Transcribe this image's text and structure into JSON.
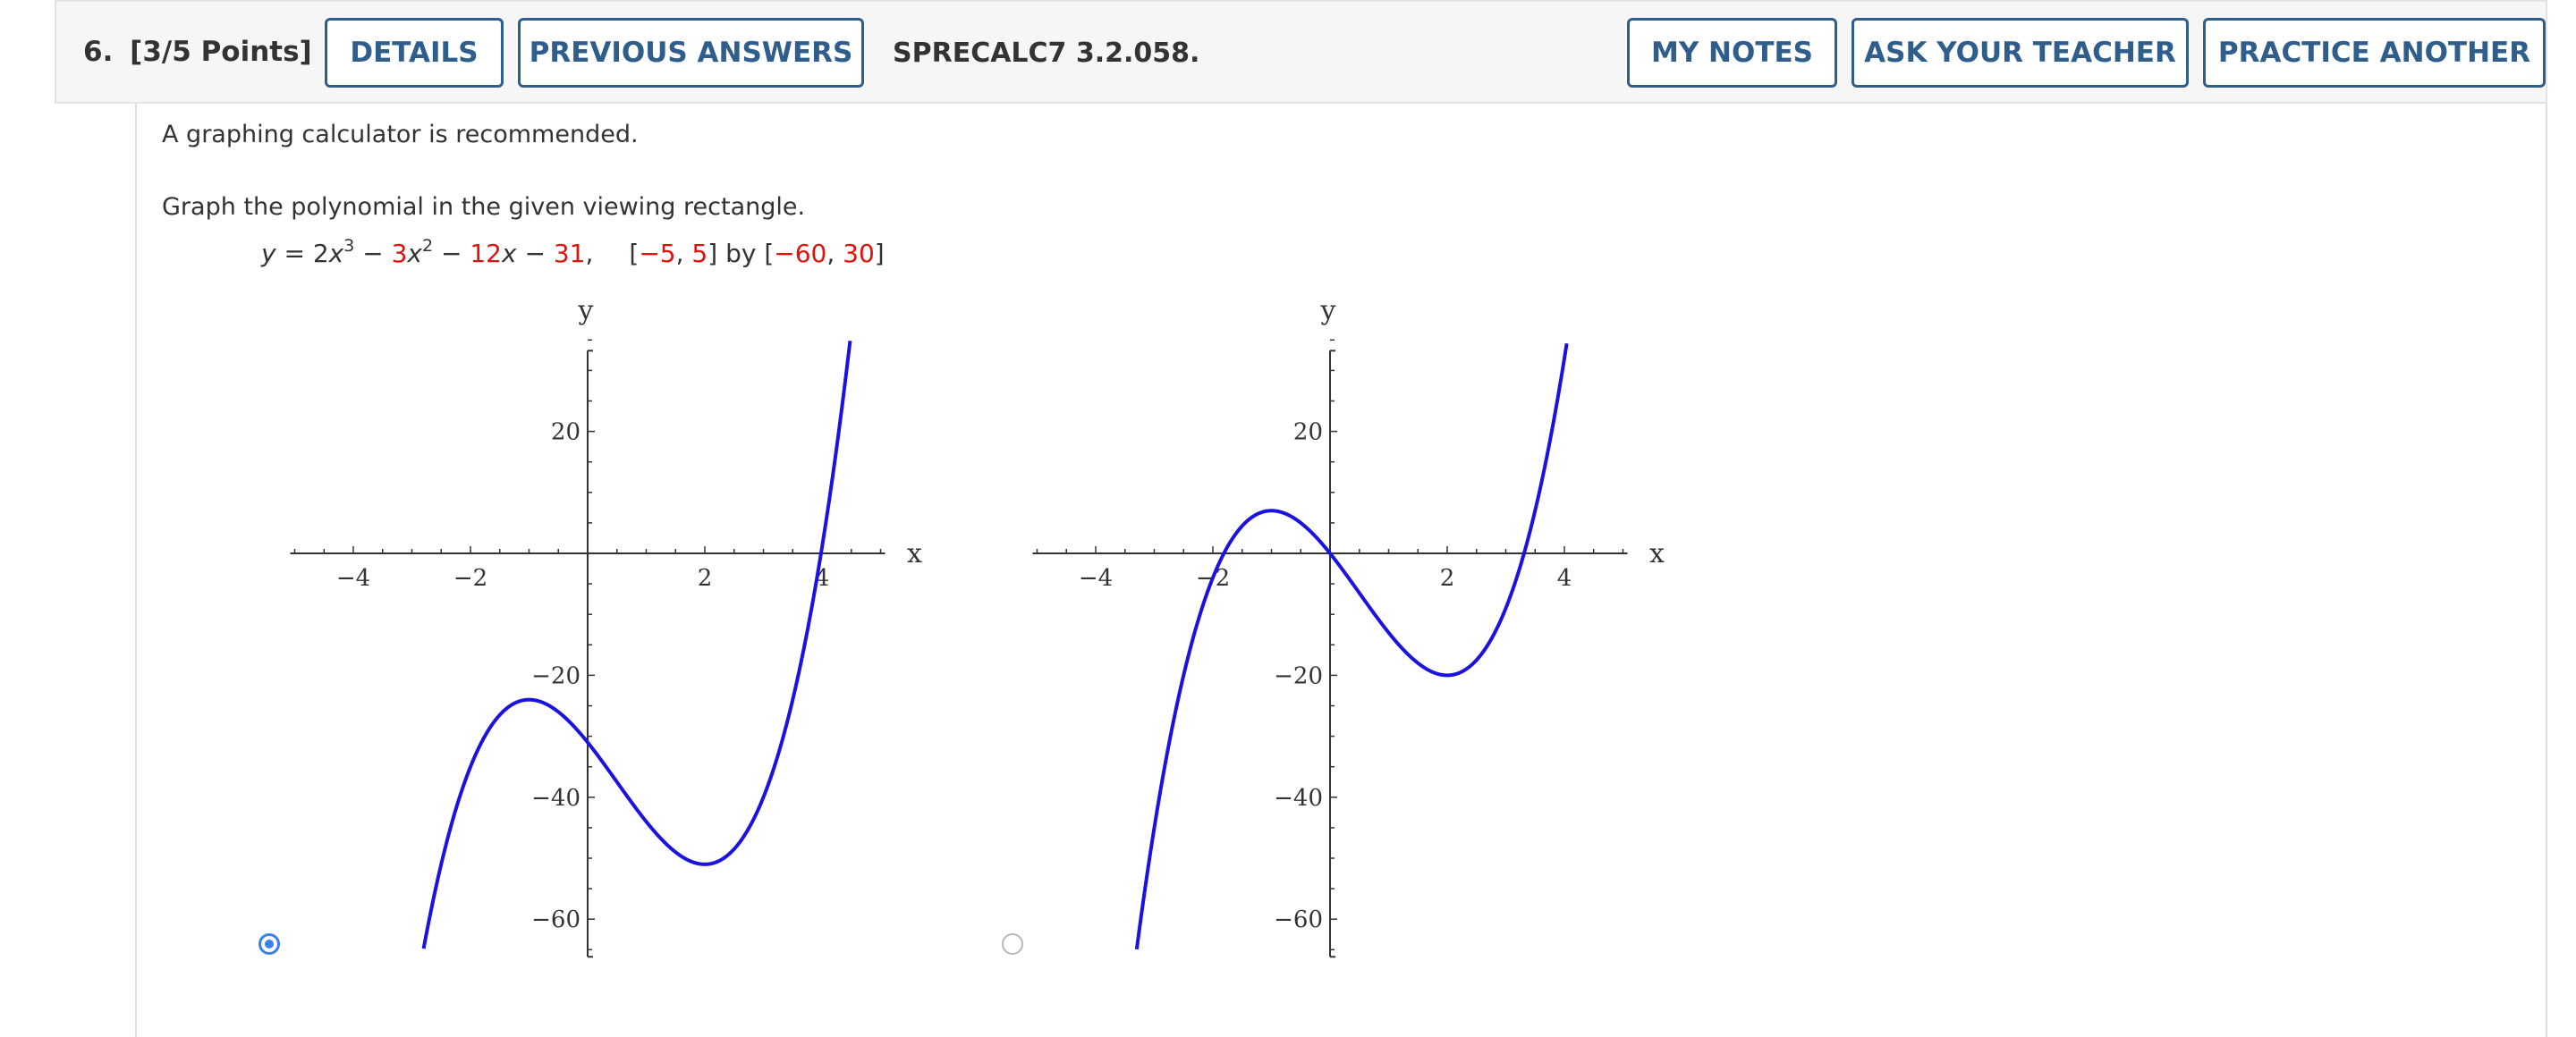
{
  "header": {
    "question_number": "6.",
    "points": "[3/5 Points]",
    "details_label": "DETAILS",
    "previous_answers_label": "PREVIOUS ANSWERS",
    "problem_code": "SPRECALC7 3.2.058.",
    "my_notes_label": "MY NOTES",
    "ask_teacher_label": "ASK YOUR TEACHER",
    "practice_another_label": "PRACTICE ANOTHER"
  },
  "content": {
    "intro": "A graphing calculator is recommended.",
    "instruction": "Graph the polynomial in the given viewing rectangle.",
    "equation": {
      "y": "y",
      "eq": " = 2",
      "x1": "x",
      "exp1": "3",
      "minus1": " − ",
      "c2": "3",
      "x2": "x",
      "exp2": "2",
      "minus2": " − ",
      "c3": "12",
      "x3": "x",
      "minus3": " − ",
      "c4": "31",
      "comma": ",",
      "rect_open": "[",
      "xmin": "−5",
      "sep1": ", ",
      "xmax": "5",
      "rect_mid": "] by [",
      "ymin": "−60",
      "sep2": ", ",
      "ymax": "30",
      "rect_close": "]"
    }
  },
  "options": [
    {
      "selected": true,
      "chart_data": {
        "type": "line",
        "function": "2x^3 - 3x^2 - 12x - 31",
        "xlim": [
          -5,
          5
        ],
        "ylim": [
          -65,
          35
        ],
        "xlabel": "x",
        "ylabel": "y",
        "xticks": [
          -4,
          -2,
          2,
          4
        ],
        "yticks": [
          20,
          -20,
          -40,
          -60
        ],
        "xtick_labels": [
          "−4",
          "−2",
          "2",
          "4"
        ],
        "ytick_labels": [
          "20",
          "−20",
          "−40",
          "−60"
        ],
        "series_color": "#1a12e0"
      }
    },
    {
      "selected": false,
      "chart_data": {
        "type": "line",
        "function": "2x^3 - 3x^2 - 12x",
        "xlim": [
          -5,
          5
        ],
        "ylim": [
          -65,
          35
        ],
        "xlabel": "x",
        "ylabel": "y",
        "xticks": [
          -4,
          -2,
          2,
          4
        ],
        "yticks": [
          20,
          -20,
          -40,
          -60
        ],
        "xtick_labels": [
          "−4",
          "−2",
          "2",
          "4"
        ],
        "ytick_labels": [
          "20",
          "−20",
          "−40",
          "−60"
        ],
        "series_color": "#1a12e0"
      }
    }
  ],
  "colors": {
    "accent": "#2f5d8c",
    "highlight": "#e0140c",
    "radio_selected": "#3b7fe8"
  }
}
